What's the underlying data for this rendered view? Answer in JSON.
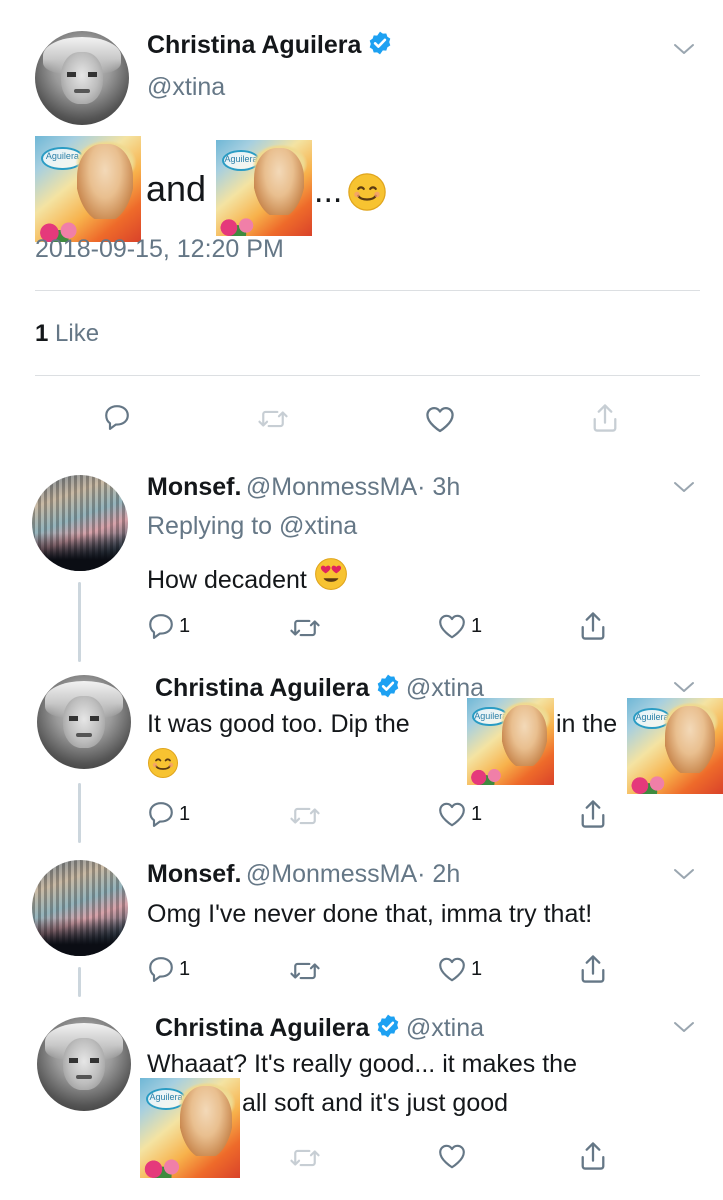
{
  "tweet": {
    "author_name": "Christina Aguilera",
    "author_handle": "@xtina",
    "text_and": "and",
    "text_ellipsis": "...",
    "timestamp": "2018-09-15, 12:20 PM",
    "likes_count": "1",
    "likes_label": "Like"
  },
  "album_logo_text": "Aguilera",
  "replies": [
    {
      "name": "Monsef.",
      "handle": "@MonmessMA",
      "time": "· 3h",
      "replying_to": "Replying to @xtina",
      "text": "How decadent",
      "reply_count": "1",
      "like_count": "1"
    },
    {
      "name": "Christina Aguilera",
      "handle": "@xtina",
      "text_a": "It was good too. Dip the",
      "text_b": "in the",
      "reply_count": "1",
      "like_count": "1"
    },
    {
      "name": "Monsef.",
      "handle": "@MonmessMA",
      "time": "· 2h",
      "text": "Omg I've never done that, imma try that!",
      "reply_count": "1",
      "like_count": "1"
    },
    {
      "name": "Christina Aguilera",
      "handle": "@xtina",
      "text_line1": "Whaaat? It's really good... it makes the",
      "text_line2": "all soft and it's just good"
    }
  ],
  "colors": {
    "verified": "#1da1f2",
    "icon_gray": "#657786",
    "icon_light": "#c7ced4",
    "divider": "#dcdfe2"
  },
  "icons": [
    "verified-badge-icon",
    "chevron-down-icon",
    "reply-icon",
    "retweet-icon",
    "like-icon",
    "share-icon",
    "smiling-emoji-icon",
    "heart-eyes-emoji-icon"
  ]
}
